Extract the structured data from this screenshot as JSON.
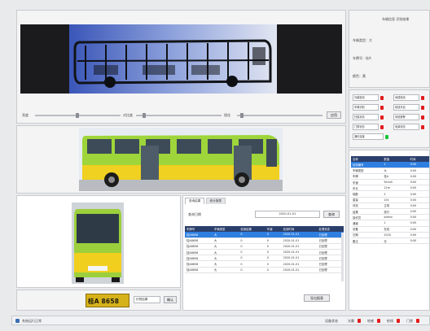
{
  "xray_panel": {
    "slider_labels": [
      "亮度",
      "对比度",
      "锐化"
    ],
    "apply_button": "应用"
  },
  "info_panel": {
    "title": "车辆信息 识别结果",
    "fields": [
      "车辆类型：大",
      "车牌号：桂A",
      "颜色：黄"
    ]
  },
  "indicators": [
    {
      "label": "光幕检测",
      "color": "#e21d1d"
    },
    {
      "label": "地感检测",
      "color": "#e21d1d"
    },
    {
      "label": "车牌识别",
      "color": "#e21d1d"
    },
    {
      "label": "射线开启",
      "color": "#e21d1d"
    },
    {
      "label": "扫描状态",
      "color": "#e21d1d"
    },
    {
      "label": "系统报警",
      "color": "#e21d1d"
    },
    {
      "label": "门禁状态",
      "color": "#e21d1d"
    },
    {
      "label": "电源状态",
      "color": "#e21d1d"
    },
    {
      "label": "通讯连接",
      "color": "#18c33a"
    }
  ],
  "right_table": {
    "headers": [
      "名称",
      "数值",
      "时间"
    ],
    "rows": [
      [
        "检测编号",
        "1",
        "0:00"
      ],
      [
        "车辆类型",
        "大",
        "0:00"
      ],
      [
        "车牌",
        "桂A",
        "0:00"
      ],
      [
        "车速",
        "5km/h",
        "0:00"
      ],
      [
        "车长",
        "12m",
        "0:00"
      ],
      [
        "轴数",
        "2",
        "0:00"
      ],
      [
        "重量",
        "15t",
        "0:00"
      ],
      [
        "状态",
        "正常",
        "0:00"
      ],
      [
        "结果",
        "放行",
        "0:00"
      ],
      [
        "操作员",
        "admin",
        "0:00"
      ],
      [
        "通道",
        "1",
        "0:00"
      ],
      [
        "设备",
        "在线",
        "0:00"
      ],
      [
        "日期",
        "2020",
        "0:00"
      ],
      [
        "备注",
        "无",
        "0:00"
      ]
    ],
    "selected_row": 0
  },
  "plate": {
    "text": "桂A 8658",
    "result_label": "识别结果",
    "confirm_button": "确认"
  },
  "records": {
    "tabs": [
      "查询结果",
      "统计报表"
    ],
    "search_label": "查询日期",
    "search_value": "2020-01-01",
    "search_button": "查询",
    "headers": [
      "车牌号",
      "车辆类型",
      "检测结果",
      "车速",
      "检测时间",
      "处理状态"
    ],
    "rows": [
      [
        "桂A8658",
        "大",
        "0",
        "0",
        "2020-01-01",
        "已处理"
      ],
      [
        "桂A8658",
        "大",
        "0",
        "0",
        "2020-01-01",
        "已处理"
      ],
      [
        "桂A8658",
        "大",
        "0",
        "0",
        "2020-01-01",
        "已处理"
      ],
      [
        "桂A8658",
        "大",
        "0",
        "0",
        "2020-01-01",
        "已处理"
      ],
      [
        "桂A8658",
        "大",
        "0",
        "0",
        "2020-01-01",
        "已处理"
      ],
      [
        "桂A8658",
        "大",
        "0",
        "0",
        "2020-01-01",
        "已处理"
      ],
      [
        "桂A8658",
        "大",
        "0",
        "0",
        "2020-01-01",
        "已处理"
      ]
    ],
    "selected_row": 0,
    "export_button": "导出报表"
  },
  "status_bar": {
    "left_text": "系统运行正常",
    "right_text": "设备状态",
    "indicator_labels": [
      "光幕",
      "地感",
      "射线",
      "门禁"
    ]
  }
}
